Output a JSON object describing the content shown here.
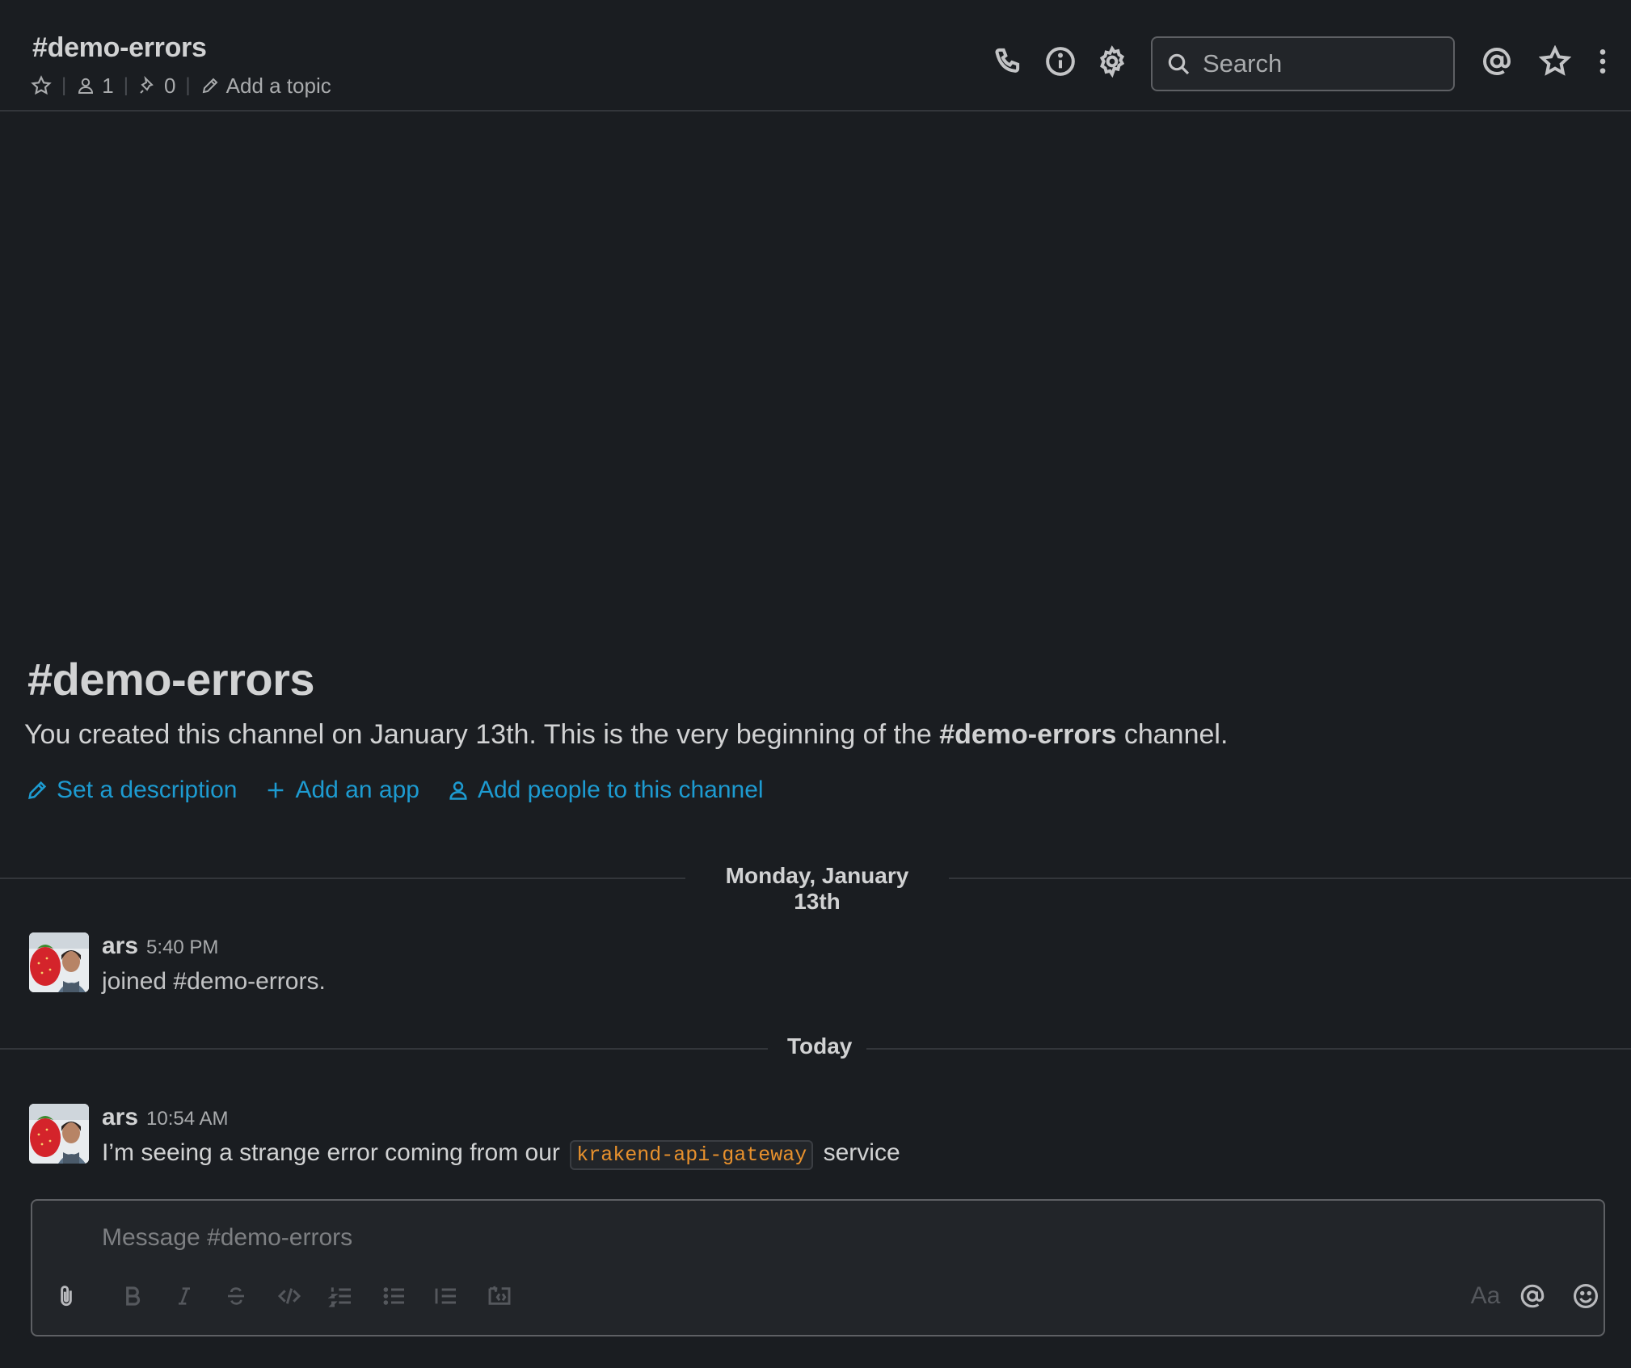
{
  "header": {
    "channel_title": "#demo-errors",
    "member_count": "1",
    "pinned_count": "0",
    "add_topic_label": "Add a topic",
    "search_placeholder": "Search"
  },
  "intro": {
    "title": "#demo-errors",
    "text_before": "You created this channel on January 13th. This is the very beginning of the ",
    "channel_name": "#demo-errors",
    "text_after": " channel.",
    "actions": {
      "set_description": "Set a description",
      "add_app": "Add an app",
      "add_people": "Add people to this channel"
    }
  },
  "dividers": {
    "first": "Monday, January 13th",
    "second": "Today"
  },
  "messages": [
    {
      "author": "ars",
      "time": "5:40 PM",
      "text": "joined #demo-errors."
    },
    {
      "author": "ars",
      "time": "10:54 AM",
      "text_before": "I’m seeing a strange error coming from our ",
      "code": "krakend-api-gateway",
      "text_after": " service"
    }
  ],
  "composer": {
    "placeholder": "Message #demo-errors",
    "format_toggle": "Aa"
  },
  "colors": {
    "background": "#1a1d21",
    "link": "#1d9bd1",
    "code": "#e8912d",
    "border": "#33363b"
  }
}
